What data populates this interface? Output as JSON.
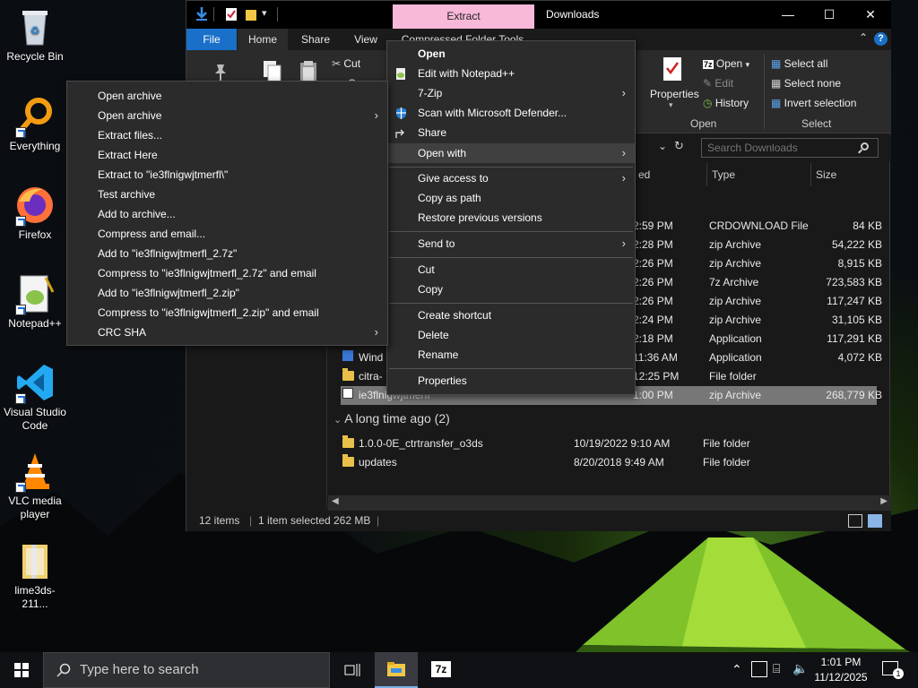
{
  "desktop": {
    "icons": [
      {
        "label": "Recycle Bin",
        "icon": "recycle-bin-icon"
      },
      {
        "label": "Everything",
        "icon": "everything-search-icon"
      },
      {
        "label": "Firefox",
        "icon": "firefox-icon"
      },
      {
        "label": "Notepad++",
        "icon": "notepad-plus-plus-icon"
      },
      {
        "label": "Visual Studio Code",
        "icon": "vscode-icon"
      },
      {
        "label": "VLC media player",
        "icon": "vlc-icon"
      },
      {
        "label": "lime3ds-211...",
        "icon": "zip-folder-icon"
      }
    ]
  },
  "explorer": {
    "context_tab": "Extract",
    "title": "Downloads",
    "tabs": {
      "file": "File",
      "home": "Home",
      "share": "Share",
      "view": "View",
      "compressed": "Compressed Folder Tools"
    },
    "ribbon": {
      "cut": "Cut",
      "copy_partial": "Copy pat",
      "properties": "Properties",
      "open": "Open",
      "edit": "Edit",
      "history": "History",
      "select_all": "Select all",
      "select_none": "Select none",
      "invert_selection": "Invert selection",
      "group_open": "Open",
      "group_select": "Select"
    },
    "search_placeholder": "Search Downloads",
    "columns": {
      "date": "ed",
      "type": "Type",
      "size": "Size"
    },
    "rows": [
      {
        "name": "",
        "date": "2:59 PM",
        "type": "CRDOWNLOAD File",
        "size": "84 KB"
      },
      {
        "name": "",
        "date": "2:28 PM",
        "type": "zip Archive",
        "size": "54,222 KB"
      },
      {
        "name": "",
        "date": "2:26 PM",
        "type": "zip Archive",
        "size": "8,915 KB"
      },
      {
        "name": "",
        "date": "2:26 PM",
        "type": "7z Archive",
        "size": "723,583 KB"
      },
      {
        "name": "",
        "date": "2:26 PM",
        "type": "zip Archive",
        "size": "117,247 KB"
      },
      {
        "name": "",
        "date": "2:24 PM",
        "type": "zip Archive",
        "size": "31,105 KB"
      },
      {
        "name": "",
        "date": "2:18 PM",
        "type": "Application",
        "size": "117,291 KB"
      },
      {
        "name": "Wind",
        "date": "11:36 AM",
        "type": "Application",
        "size": "4,072 KB"
      },
      {
        "name": "citra-",
        "date": "12:25 PM",
        "type": "File folder",
        "size": ""
      },
      {
        "name": "ie3flnigwjtmerfl",
        "date": "1:00 PM",
        "type": "zip Archive",
        "size": "268,779 KB"
      }
    ],
    "group_long_ago": "A long time ago (2)",
    "old_rows": [
      {
        "name": "1.0.0-0E_ctrtransfer_o3ds",
        "date": "10/19/2022 9:10 AM",
        "type": "File folder"
      },
      {
        "name": "updates",
        "date": "8/20/2018 9:49 AM",
        "type": "File folder"
      }
    ],
    "status": {
      "items": "12 items",
      "selected": "1 item selected",
      "size": "262 MB"
    }
  },
  "context_menu": {
    "items": [
      {
        "label": "Open",
        "bold": true
      },
      {
        "label": "Edit with Notepad++"
      },
      {
        "label": "7-Zip",
        "submenu": true
      },
      {
        "label": "Scan with Microsoft Defender..."
      },
      {
        "label": "Share"
      },
      {
        "label": "Open with",
        "submenu": true
      },
      {
        "label": "Give access to",
        "submenu": true
      },
      {
        "label": "Copy as path"
      },
      {
        "label": "Restore previous versions"
      },
      {
        "label": "Send to",
        "submenu": true
      },
      {
        "label": "Cut"
      },
      {
        "label": "Copy"
      },
      {
        "label": "Create shortcut"
      },
      {
        "label": "Delete"
      },
      {
        "label": "Rename"
      },
      {
        "label": "Properties"
      }
    ]
  },
  "zip_submenu": {
    "items": [
      "Open archive",
      "Open archive",
      "Extract files...",
      "Extract Here",
      "Extract to \"ie3flnigwjtmerfl\\\"",
      "Test archive",
      "Add to archive...",
      "Compress and email...",
      "Add to \"ie3flnigwjtmerfl_2.7z\"",
      "Compress to \"ie3flnigwjtmerfl_2.7z\" and email",
      "Add to \"ie3flnigwjtmerfl_2.zip\"",
      "Compress to \"ie3flnigwjtmerfl_2.zip\" and email",
      "CRC SHA"
    ]
  },
  "taskbar": {
    "search_placeholder": "Type here to search",
    "time": "1:01 PM",
    "date": "11/12/2025",
    "notification_count": "1"
  },
  "colors": {
    "accent": "#1a6fc8",
    "extract_tab": "#f8b8d8",
    "menu_bg": "#2b2b2b"
  }
}
